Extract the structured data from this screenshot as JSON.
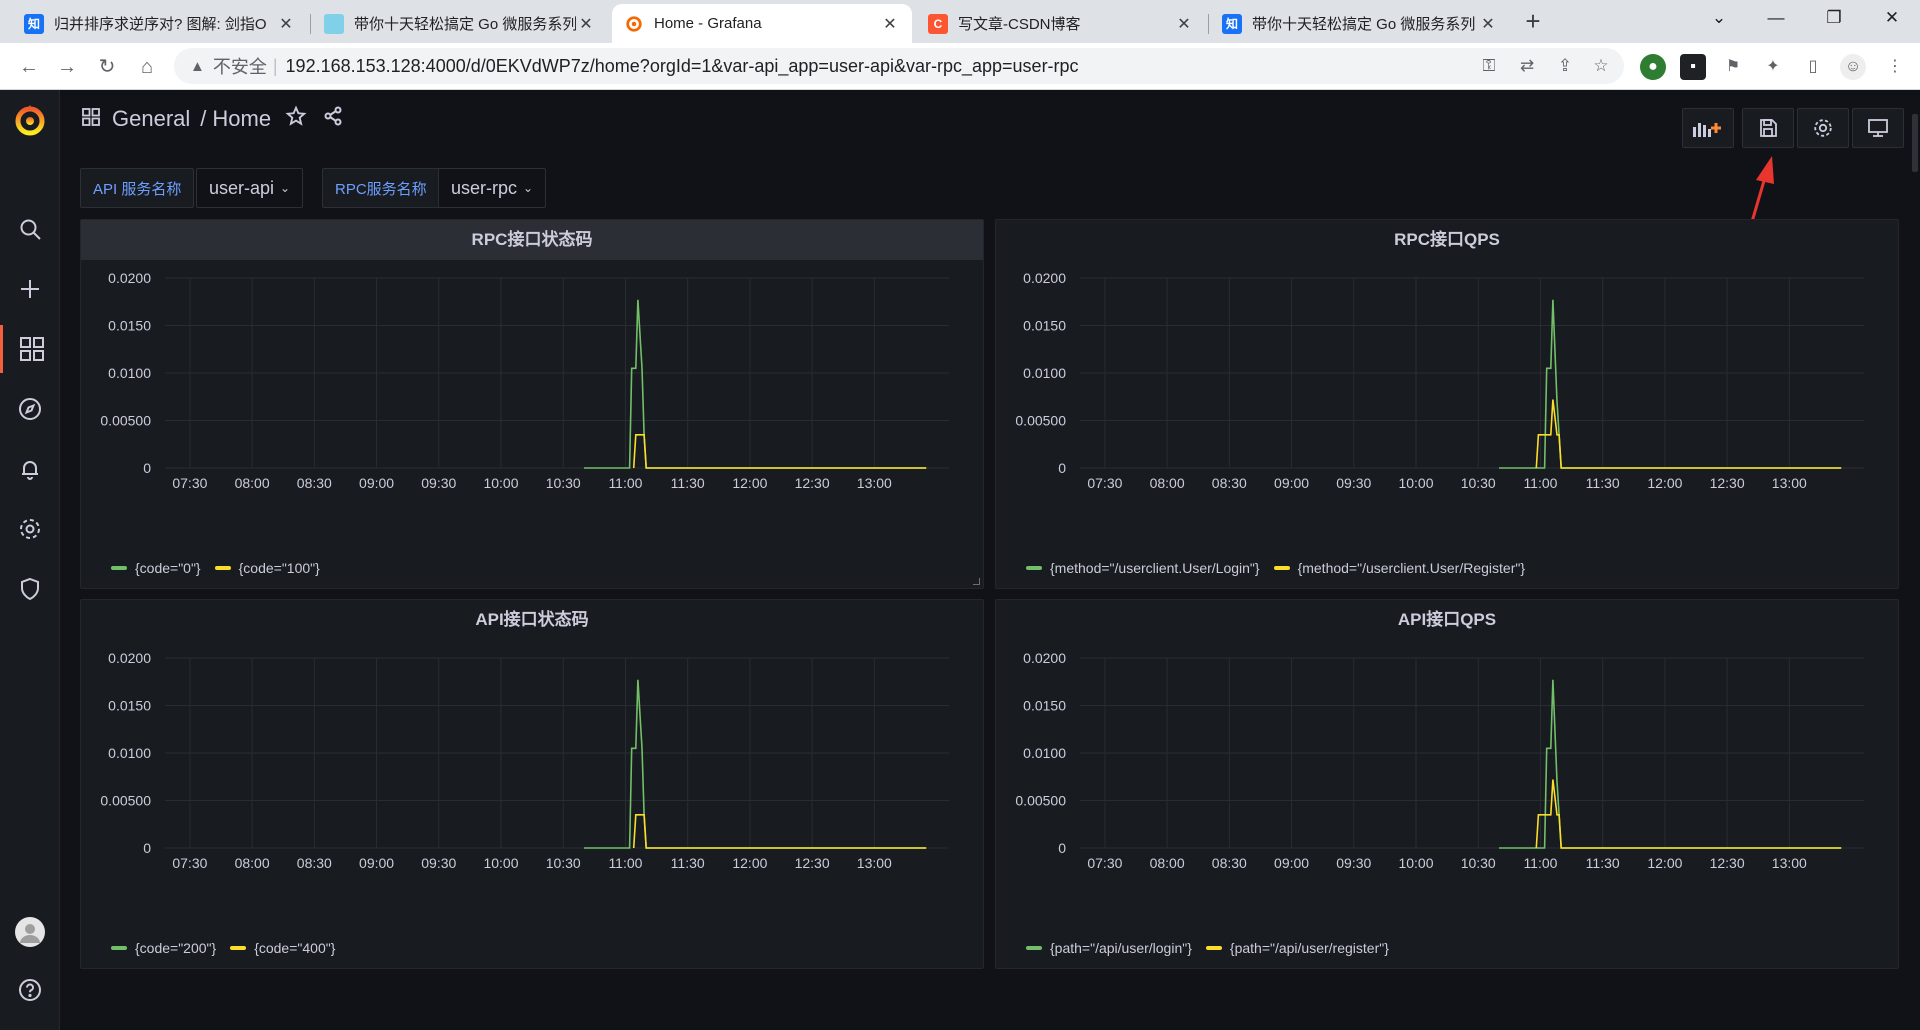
{
  "browser": {
    "tabs": [
      {
        "title": "归并排序求逆序对? 图解: 剑指O",
        "favicon": "知",
        "favicon_color": "#1772f6"
      },
      {
        "title": "带你十天轻松搞定 Go 微服务系列",
        "favicon": "",
        "favicon_color": "#7fd0e8"
      },
      {
        "title": "Home - Grafana",
        "favicon": "",
        "favicon_color": "#f46800"
      },
      {
        "title": "写文章-CSDN博客",
        "favicon": "C",
        "favicon_color": "#fc5531"
      },
      {
        "title": "带你十天轻松搞定 Go 微服务系列",
        "favicon": "知",
        "favicon_color": "#1772f6"
      }
    ],
    "insecure_label": "不安全",
    "url": "192.168.153.128:4000/d/0EKVdWP7z/home?orgId=1&var-api_app=user-api&var-rpc_app=user-rpc"
  },
  "grafana": {
    "breadcrumb": {
      "folder": "General",
      "sep": "/",
      "page": "Home"
    },
    "vars": [
      {
        "label": "API 服务名称",
        "value": "user-api"
      },
      {
        "label": "RPC服务名称",
        "value": "user-rpc"
      }
    ],
    "panels": [
      {
        "title": "RPC接口状态码",
        "legend": [
          "{code=\"0\"}",
          "{code=\"100\"}"
        ]
      },
      {
        "title": "RPC接口QPS",
        "legend": [
          "{method=\"/userclient.User/Login\"}",
          "{method=\"/userclient.User/Register\"}"
        ]
      },
      {
        "title": "API接口状态码",
        "legend": [
          "{code=\"200\"}",
          "{code=\"400\"}"
        ]
      },
      {
        "title": "API接口QPS",
        "legend": [
          "{path=\"/api/user/login\"}",
          "{path=\"/api/user/register\"}"
        ]
      }
    ]
  },
  "colors": {
    "green": "#73bf69",
    "yellow": "#fade2a",
    "accent": "#f55f3e",
    "arrow": "#e8352e"
  },
  "chart_data": [
    {
      "type": "line",
      "title": "RPC接口状态码",
      "x_ticks": [
        "07:30",
        "08:00",
        "08:30",
        "09:00",
        "09:30",
        "10:00",
        "10:30",
        "11:00",
        "11:30",
        "12:00",
        "12:30",
        "13:00"
      ],
      "y_ticks": [
        "0",
        "0.00500",
        "0.0100",
        "0.0150",
        "0.0200"
      ],
      "ylim": [
        0,
        0.02
      ],
      "series": [
        {
          "name": "{code=\"0\"}",
          "color": "#73bf69",
          "points": [
            [
              "10:40",
              0
            ],
            [
              "10:55",
              0
            ],
            [
              "11:02",
              0
            ],
            [
              "11:03",
              0.0105
            ],
            [
              "11:05",
              0.0105
            ],
            [
              "11:06",
              0.0177
            ],
            [
              "11:08",
              0.0105
            ],
            [
              "11:09",
              0.0035
            ],
            [
              "11:10",
              0
            ],
            [
              "13:25",
              0
            ]
          ]
        },
        {
          "name": "{code=\"100\"}",
          "color": "#fade2a",
          "points": [
            [
              "11:04",
              0
            ],
            [
              "11:05",
              0.0035
            ],
            [
              "11:09",
              0.0035
            ],
            [
              "11:10",
              0
            ],
            [
              "13:25",
              0
            ]
          ]
        }
      ],
      "legend": "bottom-left"
    },
    {
      "type": "line",
      "title": "RPC接口QPS",
      "x_ticks": [
        "07:30",
        "08:00",
        "08:30",
        "09:00",
        "09:30",
        "10:00",
        "10:30",
        "11:00",
        "11:30",
        "12:00",
        "12:30",
        "13:00"
      ],
      "y_ticks": [
        "0",
        "0.00500",
        "0.0100",
        "0.0150",
        "0.0200"
      ],
      "ylim": [
        0,
        0.02
      ],
      "series": [
        {
          "name": "{method=\"/userclient.User/Login\"}",
          "color": "#73bf69",
          "points": [
            [
              "10:40",
              0
            ],
            [
              "11:02",
              0
            ],
            [
              "11:03",
              0.0105
            ],
            [
              "11:05",
              0.0105
            ],
            [
              "11:06",
              0.0177
            ],
            [
              "11:08",
              0.007
            ],
            [
              "11:09",
              0.0035
            ],
            [
              "11:10",
              0
            ],
            [
              "13:25",
              0
            ]
          ]
        },
        {
          "name": "{method=\"/userclient.User/Register\"}",
          "color": "#fade2a",
          "points": [
            [
              "10:58",
              0
            ],
            [
              "10:59",
              0.0035
            ],
            [
              "11:05",
              0.0035
            ],
            [
              "11:06",
              0.0072
            ],
            [
              "11:08",
              0.0035
            ],
            [
              "11:09",
              0.0035
            ],
            [
              "11:10",
              0
            ],
            [
              "13:25",
              0
            ]
          ]
        }
      ],
      "legend": "bottom-left"
    },
    {
      "type": "line",
      "title": "API接口状态码",
      "x_ticks": [
        "07:30",
        "08:00",
        "08:30",
        "09:00",
        "09:30",
        "10:00",
        "10:30",
        "11:00",
        "11:30",
        "12:00",
        "12:30",
        "13:00"
      ],
      "y_ticks": [
        "0",
        "0.00500",
        "0.0100",
        "0.0150",
        "0.0200"
      ],
      "ylim": [
        0,
        0.02
      ],
      "series": [
        {
          "name": "{code=\"200\"}",
          "color": "#73bf69",
          "points": [
            [
              "10:40",
              0
            ],
            [
              "11:02",
              0
            ],
            [
              "11:03",
              0.0105
            ],
            [
              "11:05",
              0.0105
            ],
            [
              "11:06",
              0.0177
            ],
            [
              "11:08",
              0.0105
            ],
            [
              "11:09",
              0.0035
            ],
            [
              "11:10",
              0
            ],
            [
              "13:25",
              0
            ]
          ]
        },
        {
          "name": "{code=\"400\"}",
          "color": "#fade2a",
          "points": [
            [
              "11:04",
              0
            ],
            [
              "11:05",
              0.0035
            ],
            [
              "11:09",
              0.0035
            ],
            [
              "11:10",
              0
            ],
            [
              "13:25",
              0
            ]
          ]
        }
      ],
      "legend": "bottom-left"
    },
    {
      "type": "line",
      "title": "API接口QPS",
      "x_ticks": [
        "07:30",
        "08:00",
        "08:30",
        "09:00",
        "09:30",
        "10:00",
        "10:30",
        "11:00",
        "11:30",
        "12:00",
        "12:30",
        "13:00"
      ],
      "y_ticks": [
        "0",
        "0.00500",
        "0.0100",
        "0.0150",
        "0.0200"
      ],
      "ylim": [
        0,
        0.02
      ],
      "series": [
        {
          "name": "{path=\"/api/user/login\"}",
          "color": "#73bf69",
          "points": [
            [
              "10:40",
              0
            ],
            [
              "11:02",
              0
            ],
            [
              "11:03",
              0.0105
            ],
            [
              "11:05",
              0.0105
            ],
            [
              "11:06",
              0.0177
            ],
            [
              "11:08",
              0.007
            ],
            [
              "11:09",
              0.0035
            ],
            [
              "11:10",
              0
            ],
            [
              "13:25",
              0
            ]
          ]
        },
        {
          "name": "{path=\"/api/user/register\"}",
          "color": "#fade2a",
          "points": [
            [
              "10:58",
              0
            ],
            [
              "10:59",
              0.0035
            ],
            [
              "11:05",
              0.0035
            ],
            [
              "11:06",
              0.0072
            ],
            [
              "11:08",
              0.0035
            ],
            [
              "11:09",
              0.0035
            ],
            [
              "11:10",
              0
            ],
            [
              "13:25",
              0
            ]
          ]
        }
      ],
      "legend": "bottom-left"
    }
  ]
}
